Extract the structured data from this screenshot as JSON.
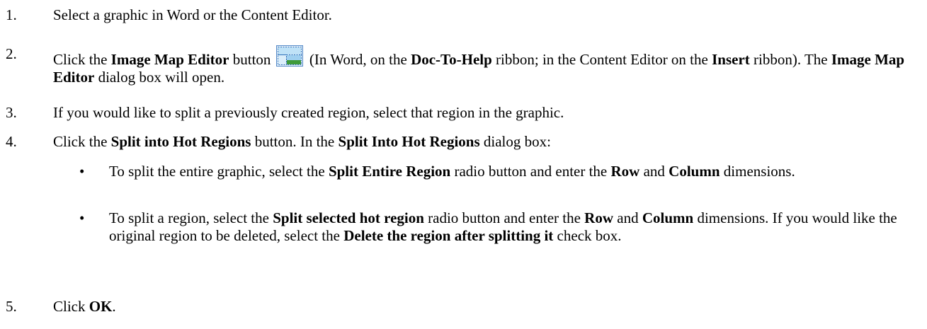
{
  "steps": [
    {
      "num": "1.",
      "parts": [
        "Select a graphic in Word or the Content Editor."
      ]
    },
    {
      "num": "2.",
      "parts": [
        "Click the ",
        "Image Map Editor",
        " button ",
        " (In Word, on the ",
        "Doc-To-Help",
        " ribbon; in the Content Editor on the ",
        "Insert",
        " ribbon). The ",
        "Image Map Editor",
        " dialog box will open."
      ]
    },
    {
      "num": "3.",
      "parts": [
        "If you would like to split a previously created region, select that region in the graphic."
      ]
    },
    {
      "num": "4.",
      "parts": [
        "Click the ",
        "Split into Hot Regions",
        " button. In the ",
        "Split Into Hot Regions",
        " dialog box:"
      ]
    },
    {
      "num": "5.",
      "parts": [
        "Click ",
        "OK",
        "."
      ]
    }
  ],
  "bullets": [
    {
      "dot": "•",
      "parts": [
        "To split the entire graphic, select the ",
        "Split Entire Region",
        " radio button and enter the ",
        "Row",
        " and ",
        "Column",
        " dimensions."
      ]
    },
    {
      "dot": "•",
      "parts": [
        "To split a region, select the ",
        "Split selected hot region",
        " radio button and enter the ",
        "Row",
        " and ",
        "Column",
        " dimensions. If you would like the original region to be deleted, select the ",
        "Delete the region after splitting it",
        " check box."
      ]
    }
  ],
  "icons": {
    "image_map_editor": "image-map-editor-icon"
  },
  "colors": {
    "icon_border": "#4f86c6",
    "icon_sky": "#9fd0f0",
    "icon_grass": "#3f9a3a",
    "icon_dash": "#2f6fb8"
  }
}
